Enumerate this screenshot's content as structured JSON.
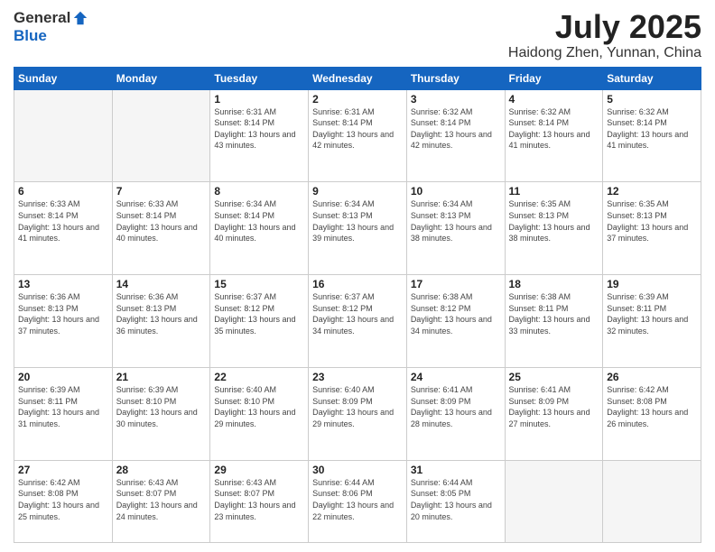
{
  "logo": {
    "general": "General",
    "blue": "Blue"
  },
  "header": {
    "month": "July 2025",
    "location": "Haidong Zhen, Yunnan, China"
  },
  "weekdays": [
    "Sunday",
    "Monday",
    "Tuesday",
    "Wednesday",
    "Thursday",
    "Friday",
    "Saturday"
  ],
  "weeks": [
    [
      {
        "day": "",
        "sunrise": "",
        "sunset": "",
        "daylight": ""
      },
      {
        "day": "",
        "sunrise": "",
        "sunset": "",
        "daylight": ""
      },
      {
        "day": "1",
        "sunrise": "Sunrise: 6:31 AM",
        "sunset": "Sunset: 8:14 PM",
        "daylight": "Daylight: 13 hours and 43 minutes."
      },
      {
        "day": "2",
        "sunrise": "Sunrise: 6:31 AM",
        "sunset": "Sunset: 8:14 PM",
        "daylight": "Daylight: 13 hours and 42 minutes."
      },
      {
        "day": "3",
        "sunrise": "Sunrise: 6:32 AM",
        "sunset": "Sunset: 8:14 PM",
        "daylight": "Daylight: 13 hours and 42 minutes."
      },
      {
        "day": "4",
        "sunrise": "Sunrise: 6:32 AM",
        "sunset": "Sunset: 8:14 PM",
        "daylight": "Daylight: 13 hours and 41 minutes."
      },
      {
        "day": "5",
        "sunrise": "Sunrise: 6:32 AM",
        "sunset": "Sunset: 8:14 PM",
        "daylight": "Daylight: 13 hours and 41 minutes."
      }
    ],
    [
      {
        "day": "6",
        "sunrise": "Sunrise: 6:33 AM",
        "sunset": "Sunset: 8:14 PM",
        "daylight": "Daylight: 13 hours and 41 minutes."
      },
      {
        "day": "7",
        "sunrise": "Sunrise: 6:33 AM",
        "sunset": "Sunset: 8:14 PM",
        "daylight": "Daylight: 13 hours and 40 minutes."
      },
      {
        "day": "8",
        "sunrise": "Sunrise: 6:34 AM",
        "sunset": "Sunset: 8:14 PM",
        "daylight": "Daylight: 13 hours and 40 minutes."
      },
      {
        "day": "9",
        "sunrise": "Sunrise: 6:34 AM",
        "sunset": "Sunset: 8:13 PM",
        "daylight": "Daylight: 13 hours and 39 minutes."
      },
      {
        "day": "10",
        "sunrise": "Sunrise: 6:34 AM",
        "sunset": "Sunset: 8:13 PM",
        "daylight": "Daylight: 13 hours and 38 minutes."
      },
      {
        "day": "11",
        "sunrise": "Sunrise: 6:35 AM",
        "sunset": "Sunset: 8:13 PM",
        "daylight": "Daylight: 13 hours and 38 minutes."
      },
      {
        "day": "12",
        "sunrise": "Sunrise: 6:35 AM",
        "sunset": "Sunset: 8:13 PM",
        "daylight": "Daylight: 13 hours and 37 minutes."
      }
    ],
    [
      {
        "day": "13",
        "sunrise": "Sunrise: 6:36 AM",
        "sunset": "Sunset: 8:13 PM",
        "daylight": "Daylight: 13 hours and 37 minutes."
      },
      {
        "day": "14",
        "sunrise": "Sunrise: 6:36 AM",
        "sunset": "Sunset: 8:13 PM",
        "daylight": "Daylight: 13 hours and 36 minutes."
      },
      {
        "day": "15",
        "sunrise": "Sunrise: 6:37 AM",
        "sunset": "Sunset: 8:12 PM",
        "daylight": "Daylight: 13 hours and 35 minutes."
      },
      {
        "day": "16",
        "sunrise": "Sunrise: 6:37 AM",
        "sunset": "Sunset: 8:12 PM",
        "daylight": "Daylight: 13 hours and 34 minutes."
      },
      {
        "day": "17",
        "sunrise": "Sunrise: 6:38 AM",
        "sunset": "Sunset: 8:12 PM",
        "daylight": "Daylight: 13 hours and 34 minutes."
      },
      {
        "day": "18",
        "sunrise": "Sunrise: 6:38 AM",
        "sunset": "Sunset: 8:11 PM",
        "daylight": "Daylight: 13 hours and 33 minutes."
      },
      {
        "day": "19",
        "sunrise": "Sunrise: 6:39 AM",
        "sunset": "Sunset: 8:11 PM",
        "daylight": "Daylight: 13 hours and 32 minutes."
      }
    ],
    [
      {
        "day": "20",
        "sunrise": "Sunrise: 6:39 AM",
        "sunset": "Sunset: 8:11 PM",
        "daylight": "Daylight: 13 hours and 31 minutes."
      },
      {
        "day": "21",
        "sunrise": "Sunrise: 6:39 AM",
        "sunset": "Sunset: 8:10 PM",
        "daylight": "Daylight: 13 hours and 30 minutes."
      },
      {
        "day": "22",
        "sunrise": "Sunrise: 6:40 AM",
        "sunset": "Sunset: 8:10 PM",
        "daylight": "Daylight: 13 hours and 29 minutes."
      },
      {
        "day": "23",
        "sunrise": "Sunrise: 6:40 AM",
        "sunset": "Sunset: 8:09 PM",
        "daylight": "Daylight: 13 hours and 29 minutes."
      },
      {
        "day": "24",
        "sunrise": "Sunrise: 6:41 AM",
        "sunset": "Sunset: 8:09 PM",
        "daylight": "Daylight: 13 hours and 28 minutes."
      },
      {
        "day": "25",
        "sunrise": "Sunrise: 6:41 AM",
        "sunset": "Sunset: 8:09 PM",
        "daylight": "Daylight: 13 hours and 27 minutes."
      },
      {
        "day": "26",
        "sunrise": "Sunrise: 6:42 AM",
        "sunset": "Sunset: 8:08 PM",
        "daylight": "Daylight: 13 hours and 26 minutes."
      }
    ],
    [
      {
        "day": "27",
        "sunrise": "Sunrise: 6:42 AM",
        "sunset": "Sunset: 8:08 PM",
        "daylight": "Daylight: 13 hours and 25 minutes."
      },
      {
        "day": "28",
        "sunrise": "Sunrise: 6:43 AM",
        "sunset": "Sunset: 8:07 PM",
        "daylight": "Daylight: 13 hours and 24 minutes."
      },
      {
        "day": "29",
        "sunrise": "Sunrise: 6:43 AM",
        "sunset": "Sunset: 8:07 PM",
        "daylight": "Daylight: 13 hours and 23 minutes."
      },
      {
        "day": "30",
        "sunrise": "Sunrise: 6:44 AM",
        "sunset": "Sunset: 8:06 PM",
        "daylight": "Daylight: 13 hours and 22 minutes."
      },
      {
        "day": "31",
        "sunrise": "Sunrise: 6:44 AM",
        "sunset": "Sunset: 8:05 PM",
        "daylight": "Daylight: 13 hours and 20 minutes."
      },
      {
        "day": "",
        "sunrise": "",
        "sunset": "",
        "daylight": ""
      },
      {
        "day": "",
        "sunrise": "",
        "sunset": "",
        "daylight": ""
      }
    ]
  ]
}
